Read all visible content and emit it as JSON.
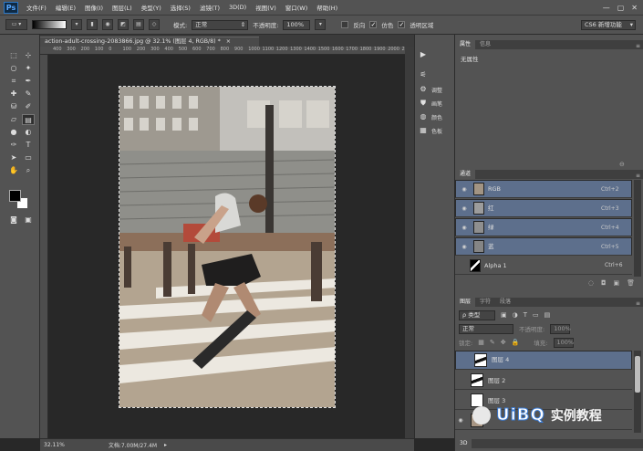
{
  "app": {
    "logo": "Ps",
    "window_controls": [
      "—",
      "▢",
      "✕"
    ]
  },
  "menu": [
    "文件(F)",
    "编辑(E)",
    "图像(I)",
    "图层(L)",
    "类型(Y)",
    "选择(S)",
    "滤镜(T)",
    "3D(D)",
    "视图(V)",
    "窗口(W)",
    "帮助(H)"
  ],
  "options": {
    "mode_label": "模式:",
    "mode_value": "正常",
    "opacity_label": "不透明度:",
    "opacity_value": "100%",
    "reverse_label": "反向",
    "dither_label": "仿色",
    "transparency_label": "透明区域",
    "workspace": "CS6 新增功能"
  },
  "document": {
    "tab_title": "action-adult-crossing-2083866.jpg @ 32.1% (图层 4, RGB/8) *",
    "zoom": "32.11%",
    "doc_size": "文档:7.00M/27.4M",
    "ruler_ticks": [
      "400",
      "300",
      "200",
      "100",
      "0",
      "100",
      "200",
      "300",
      "400",
      "500",
      "600",
      "700",
      "800",
      "900",
      "1000",
      "1100",
      "1200",
      "1300",
      "1400",
      "1500",
      "1600",
      "1700",
      "1800",
      "1900",
      "2000",
      "2100"
    ]
  },
  "dock": {
    "items": [
      {
        "icon": "play-icon",
        "label": ""
      },
      {
        "icon": "brush-preset-icon",
        "label": ""
      },
      {
        "icon": "adjust-icon",
        "label": "调整"
      },
      {
        "icon": "stamp-icon",
        "label": "画笔"
      },
      {
        "icon": "swatches-icon",
        "label": "颜色"
      },
      {
        "icon": "styles-icon",
        "label": "色板"
      }
    ]
  },
  "properties": {
    "tabs": [
      "属性",
      "信息"
    ],
    "content": "无属性"
  },
  "channels": {
    "tab": "通道",
    "rows": [
      {
        "name": "RGB",
        "shortcut": "Ctrl+2",
        "selected": true
      },
      {
        "name": "红",
        "shortcut": "Ctrl+3",
        "selected": true
      },
      {
        "name": "绿",
        "shortcut": "Ctrl+4",
        "selected": true
      },
      {
        "name": "蓝",
        "shortcut": "Ctrl+5",
        "selected": true
      },
      {
        "name": "Alpha 1",
        "shortcut": "Ctrl+6",
        "selected": false
      }
    ]
  },
  "layers": {
    "tabs": [
      "图层",
      "字符",
      "段落"
    ],
    "filter_label": "ρ 类型",
    "blend_mode": "正常",
    "opacity_label": "不透明度:",
    "opacity_value": "100%",
    "lock_label": "锁定:",
    "fill_label": "填充:",
    "fill_value": "100%",
    "rows": [
      {
        "name": "图层 4",
        "selected": true
      },
      {
        "name": "图层 2",
        "selected": false
      },
      {
        "name": "图层 3",
        "selected": false
      },
      {
        "name": "",
        "selected": false
      }
    ],
    "bottom_tab": "3D"
  },
  "watermark": {
    "text": "UiBQ",
    "text2": "实例教程"
  }
}
